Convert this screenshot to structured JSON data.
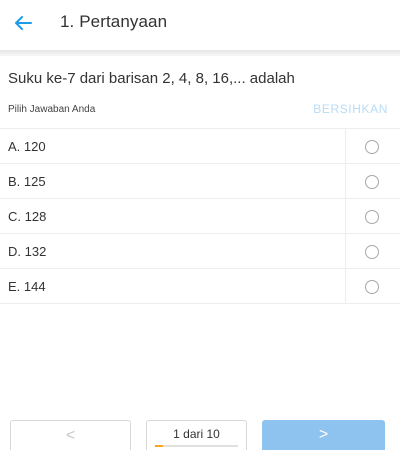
{
  "header": {
    "back_icon": "arrow-left-icon",
    "title": "1. Pertanyaan",
    "accent_color": "#1e9be9"
  },
  "question": {
    "text": "Suku ke-7 dari barisan 2, 4, 8, 16,... adalah",
    "prompt": "Pilih Jawaban Anda",
    "clear_label": "BERSIHKAN",
    "clear_color": "#b7dcf6"
  },
  "options": [
    {
      "label": "A. 120",
      "selected": false
    },
    {
      "label": "B. 125",
      "selected": false
    },
    {
      "label": "C. 128",
      "selected": false
    },
    {
      "label": "D. 132",
      "selected": false
    },
    {
      "label": "E. 144",
      "selected": false
    }
  ],
  "navigation": {
    "prev_label": "<",
    "page_indicator": "1 dari 10",
    "current_page": 1,
    "total_pages": 10,
    "progress_fraction": 0.1,
    "progress_color": "#f5a623",
    "next_label": ">",
    "next_color": "#8ec3f0"
  }
}
